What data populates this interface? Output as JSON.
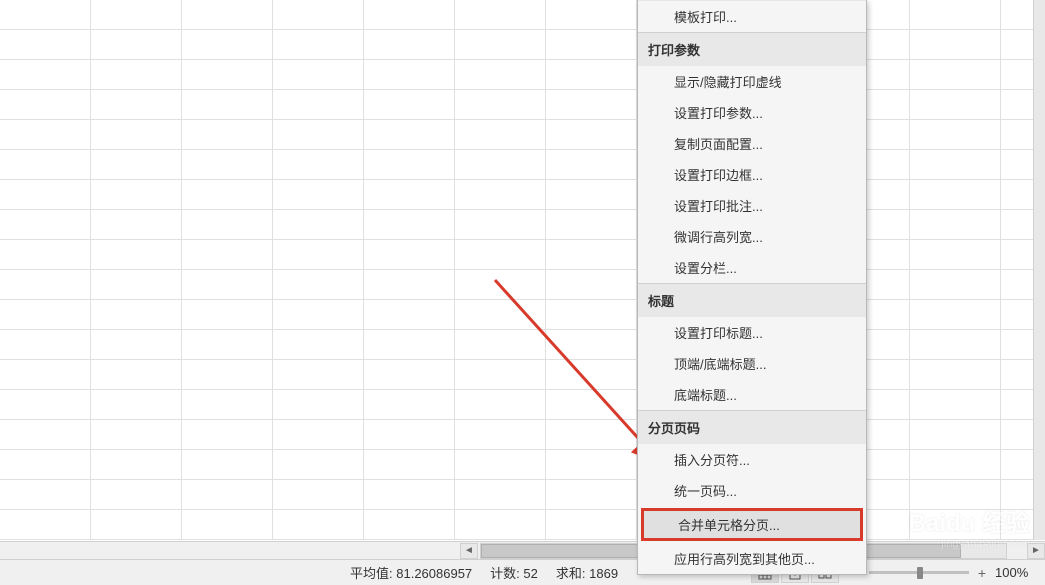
{
  "menu": {
    "top_item": "模板打印...",
    "sections": [
      {
        "header": "打印参数",
        "items": [
          "显示/隐藏打印虚线",
          "设置打印参数...",
          "复制页面配置...",
          "设置打印边框...",
          "设置打印批注...",
          "微调行高列宽...",
          "设置分栏..."
        ]
      },
      {
        "header": "标题",
        "items": [
          "设置打印标题...",
          "顶端/底端标题...",
          "底端标题..."
        ]
      },
      {
        "header": "分页页码",
        "items": [
          "插入分页符...",
          "统一页码...",
          "合并单元格分页...",
          "应用行高列宽到其他页..."
        ]
      }
    ]
  },
  "highlighted_item_index": {
    "section": 2,
    "item": 2
  },
  "status_bar": {
    "average_label": "平均值:",
    "average_value": "81.26086957",
    "count_label": "计数:",
    "count_value": "52",
    "sum_label": "求和:",
    "sum_value": "1869",
    "zoom": "100%"
  },
  "watermark": {
    "main": "Baidu 经验",
    "sub": "jingyan.baidu.com"
  }
}
